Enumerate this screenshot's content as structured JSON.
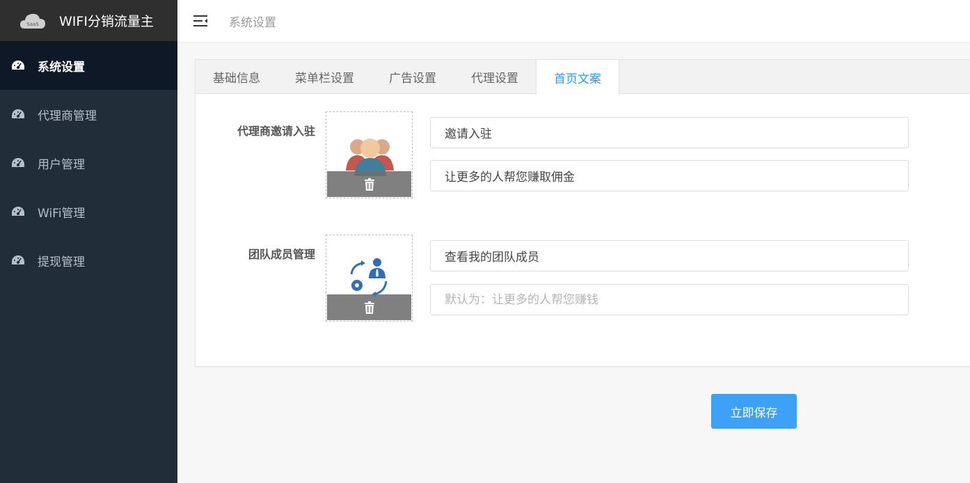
{
  "app": {
    "title": "WIFI分销流量主",
    "logo_text": "SaaS"
  },
  "sidebar": {
    "items": [
      {
        "label": "系统设置"
      },
      {
        "label": "代理商管理"
      },
      {
        "label": "用户管理"
      },
      {
        "label": "WiFi管理"
      },
      {
        "label": "提现管理"
      }
    ]
  },
  "header": {
    "breadcrumb": "系统设置"
  },
  "tabs": [
    {
      "label": "基础信息"
    },
    {
      "label": "菜单栏设置"
    },
    {
      "label": "广告设置"
    },
    {
      "label": "代理设置"
    },
    {
      "label": "首页文案"
    }
  ],
  "form": {
    "rows": [
      {
        "label": "代理商邀请入驻",
        "title_value": "邀请入驻",
        "subtitle_value": "让更多的人帮您赚取佣金",
        "subtitle_placeholder": ""
      },
      {
        "label": "团队成员管理",
        "title_value": "查看我的团队成员",
        "subtitle_value": "",
        "subtitle_placeholder": "默认为：让更多的人帮您赚钱"
      }
    ]
  },
  "actions": {
    "save_label": "立即保存"
  },
  "colors": {
    "accent": "#1e9fff",
    "button": "#3da1f7",
    "sidebar": "#222d3a",
    "sidebar_active": "#0e1826"
  }
}
